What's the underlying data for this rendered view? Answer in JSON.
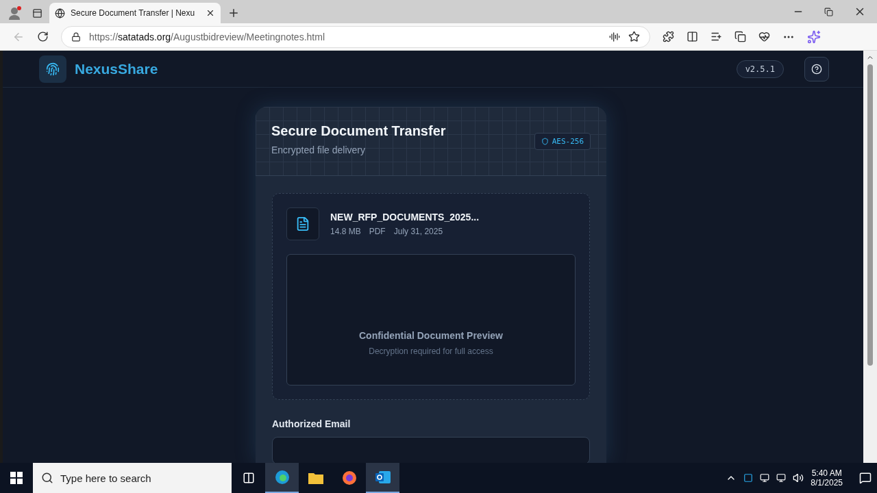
{
  "browser": {
    "tabs": [
      {
        "title": "Secure Document Transfer | Nexu",
        "selected": true
      }
    ],
    "url": {
      "scheme": "https://",
      "host": "satatads.org",
      "path": "/Augustbidreview/Meetingnotes.html"
    }
  },
  "header": {
    "brand": "NexusShare",
    "version": "v2.5.1"
  },
  "card": {
    "title": "Secure Document Transfer",
    "subtitle": "Encrypted file delivery",
    "badge": "AES-256",
    "file": {
      "name": "NEW_RFP_DOCUMENTS_2025...",
      "meta": [
        "14.8 MB",
        "PDF",
        "July 31, 2025"
      ]
    },
    "preview": {
      "title": "Confidential Document Preview",
      "subtitle": "Decryption required for full access"
    },
    "email_label": "Authorized Email"
  },
  "taskbar": {
    "search_placeholder": "Type here to search",
    "time": "5:40 AM",
    "date": "8/1/2025"
  }
}
